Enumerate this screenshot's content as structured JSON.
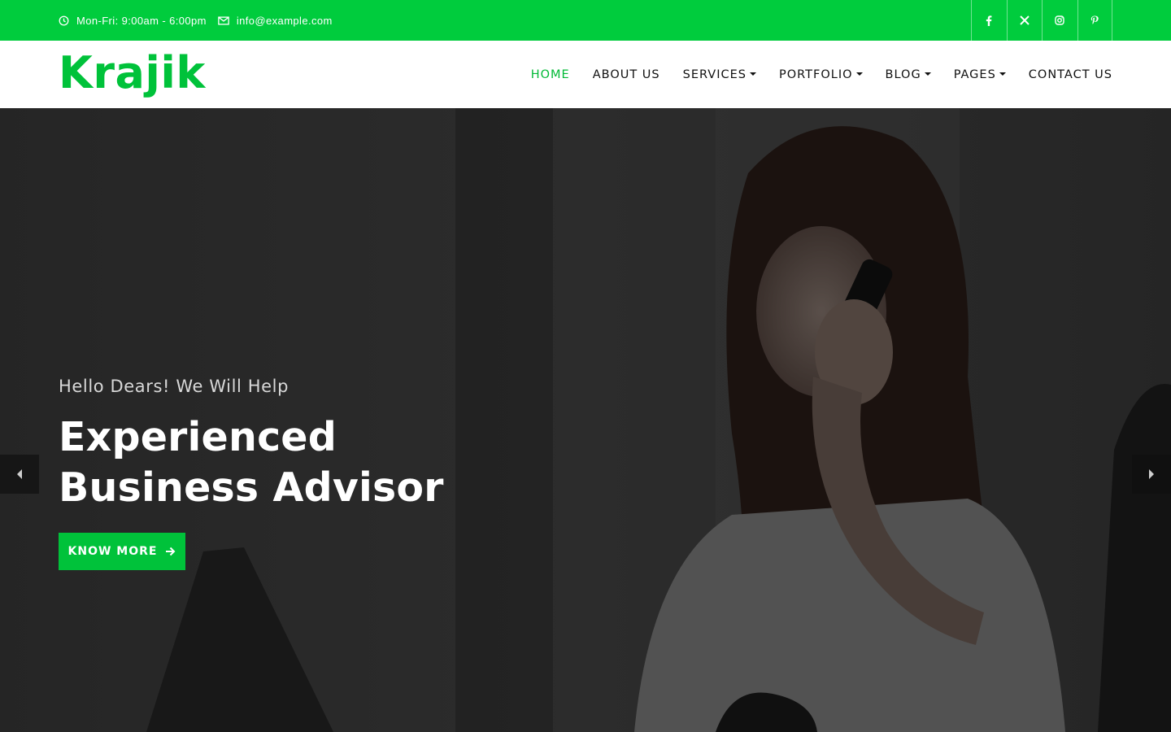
{
  "topbar": {
    "hours": "Mon-Fri: 9:00am - 6:00pm",
    "email": "info@example.com",
    "social": [
      {
        "name": "facebook-icon",
        "glyph": "f"
      },
      {
        "name": "x-twitter-icon",
        "glyph": "𝕏"
      },
      {
        "name": "instagram-icon",
        "glyph": ""
      },
      {
        "name": "pinterest-icon",
        "glyph": "P"
      }
    ]
  },
  "navbar": {
    "logo": "Krajik",
    "menu": [
      {
        "label": "HOME",
        "active": true,
        "dropdown": false
      },
      {
        "label": "ABOUT US",
        "active": false,
        "dropdown": false
      },
      {
        "label": "SERVICES",
        "active": false,
        "dropdown": true
      },
      {
        "label": "PORTFOLIO",
        "active": false,
        "dropdown": true
      },
      {
        "label": "BLOG",
        "active": false,
        "dropdown": true
      },
      {
        "label": "PAGES",
        "active": false,
        "dropdown": true
      },
      {
        "label": "CONTACT US",
        "active": false,
        "dropdown": false
      }
    ]
  },
  "hero": {
    "kicker": "Hello Dears! We Will Help",
    "headline": "Experienced Business Advisor",
    "button_label": "KNOW MORE"
  },
  "colors": {
    "accent": "#00cc3d",
    "logo": "#00c23a",
    "hero_overlay": "#2f2f2f"
  }
}
